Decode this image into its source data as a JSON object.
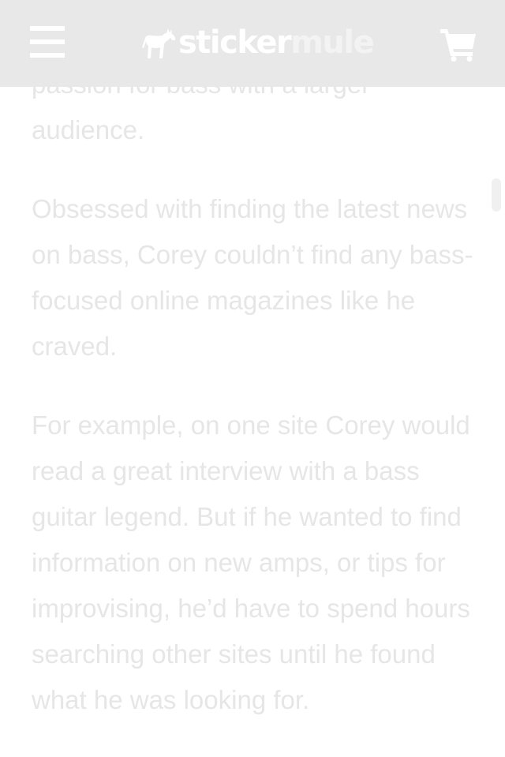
{
  "header": {
    "logo": {
      "part1": "sticker",
      "part2": "mule",
      "icon": "mule-icon"
    },
    "menu_icon": "hamburger-menu-icon",
    "cart_icon": "shopping-cart-icon"
  },
  "article": {
    "partial_line": "passion for bass with a larger",
    "paragraphs": [
      "audience.",
      "Obsessed with finding the latest news on bass, Corey couldn’t find any bass-focused online magazines like he craved.",
      "For example, on one site Corey would read a great interview with a bass guitar legend. But if he wanted to find information on new amps, or tips for improvising, he’d have to spend hours searching other sites until he found what he was looking for."
    ]
  },
  "colors": {
    "navbar_background": "#e8e8e8",
    "icons": "#ffffff",
    "body_text": "#e6e6e6"
  }
}
